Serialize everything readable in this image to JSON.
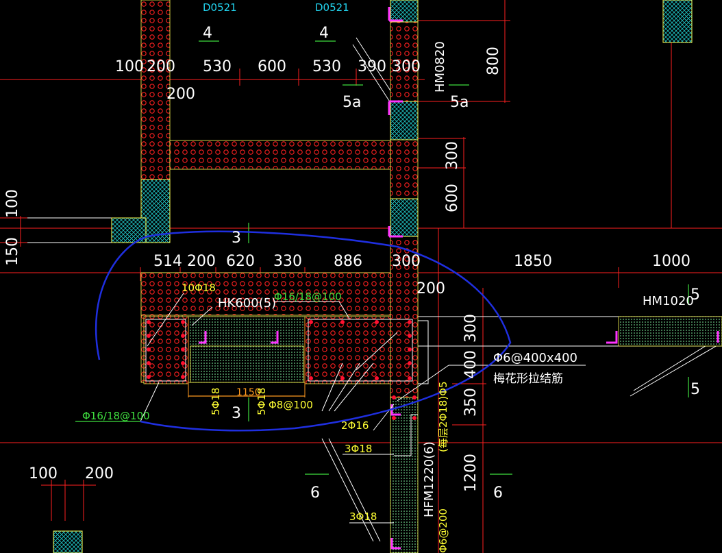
{
  "drawing": {
    "labels": {
      "door_top_1": "D0521",
      "door_top_2": "D0521",
      "sec4_a": "4",
      "sec4_b": "4",
      "sec5a_a": "5a",
      "sec5a_b": "5a",
      "hm0820": "HM0820",
      "sec3_top": "3",
      "sec3_bottom": "3",
      "hk600": "HK600(5)",
      "hm1020": "HM1020",
      "sec5_a": "5",
      "sec5_b": "5",
      "sec6_a": "6",
      "sec6_b": "6",
      "hfm1220": "HFM1220(6)",
      "hfm_under": "Φ6@200",
      "plum_note": "梅花形拉结筋"
    },
    "dimensions": {
      "top_row": [
        "100",
        "200",
        "530",
        "600",
        "530",
        "390",
        "300"
      ],
      "top_200_below": "200",
      "right_800": "800",
      "right_300": "300",
      "right_600": "600",
      "left_100": "100",
      "left_150": "150",
      "mid_row": [
        "514",
        "200",
        "620",
        "330",
        "886",
        "300",
        "1850",
        "1000"
      ],
      "mid_200": "200",
      "right_col": [
        "300",
        "400",
        "350",
        "1200"
      ],
      "bottom_100": "100",
      "bottom_200": "200",
      "span_1150": "1150"
    },
    "rebar": {
      "r10phi18": "10Φ18",
      "r16_18_100_top": "Φ16/18@100",
      "r16_18_100_left": "Φ16/18@100",
      "r5phi18_a": "5Φ18",
      "r5phi18_b": "5Φ18",
      "r8_100": "Φ8@100",
      "r2phi16": "2Φ16",
      "r3phi18_a": "3Φ18",
      "r3phi18_b": "3Φ18",
      "r6_400": "Φ6@400x400",
      "r_vertical": "(每层2Φ18)Φ5"
    }
  }
}
